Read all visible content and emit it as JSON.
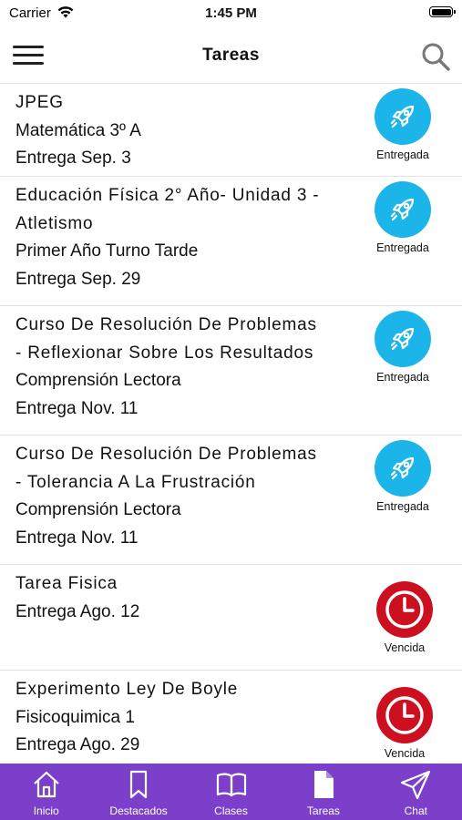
{
  "status_bar": {
    "carrier": "Carrier",
    "time": "1:45 PM"
  },
  "nav": {
    "title": "Tareas"
  },
  "colors": {
    "accent": "#7b3fc9",
    "delivered": "#1cb5ea",
    "overdue": "#cc1020"
  },
  "tasks": [
    {
      "lines": [
        "JPEG",
        "Matemática 3º A",
        "Entrega Sep. 3"
      ],
      "status": "Entregada",
      "icon": "rocket-icon"
    },
    {
      "lines": [
        "Educación Física 2° Año- Unidad 3 -",
        "Atletismo",
        "Primer Año Turno Tarde",
        "Entrega Sep. 29"
      ],
      "status": "Entregada",
      "icon": "rocket-icon"
    },
    {
      "lines": [
        "Curso De Resolución De Problemas",
        "- Reflexionar Sobre Los Resultados",
        "Comprensión Lectora",
        "Entrega Nov. 11"
      ],
      "status": "Entregada",
      "icon": "rocket-icon"
    },
    {
      "lines": [
        "Curso De Resolución De Problemas",
        "- Tolerancia A La Frustración",
        "Comprensión Lectora",
        "Entrega Nov. 11"
      ],
      "status": "Entregada",
      "icon": "rocket-icon"
    },
    {
      "lines": [
        "Tarea Fisica",
        "Entrega Ago. 12"
      ],
      "status": "Vencida",
      "icon": "clock-icon"
    },
    {
      "lines": [
        "Experimento Ley De Boyle",
        "Fisicoquimica 1",
        "Entrega Ago. 29"
      ],
      "status": "Vencida",
      "icon": "clock-icon"
    }
  ],
  "tabbar": {
    "items": [
      {
        "label": "Inicio",
        "icon": "home-icon"
      },
      {
        "label": "Destacados",
        "icon": "bookmark-icon"
      },
      {
        "label": "Clases",
        "icon": "book-icon"
      },
      {
        "label": "Tareas",
        "icon": "document-icon"
      },
      {
        "label": "Chat",
        "icon": "send-icon"
      }
    ]
  }
}
